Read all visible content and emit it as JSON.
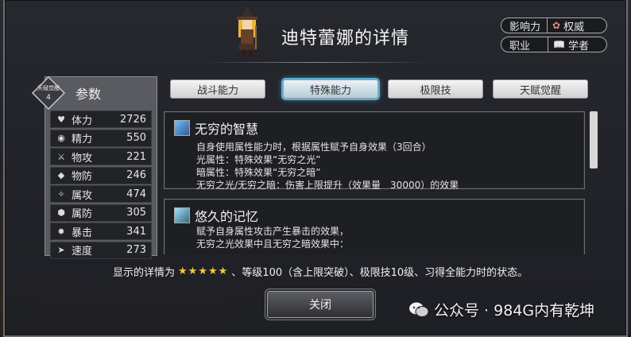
{
  "dialog": {
    "title": "迪特蕾娜的详情",
    "influence": {
      "label": "影响力",
      "value": "权威"
    },
    "job": {
      "label": "职业",
      "value": "学者"
    }
  },
  "left_panel": {
    "awaken_badge_label": "天赋觉醒",
    "awaken_badge_value": "4",
    "heading": "参数",
    "stats": [
      {
        "name": "体力",
        "value": "2726",
        "icon": "heart-icon"
      },
      {
        "name": "精力",
        "value": "550",
        "icon": "drop-icon"
      },
      {
        "name": "物攻",
        "value": "221",
        "icon": "sword-icon"
      },
      {
        "name": "物防",
        "value": "246",
        "icon": "shield-icon"
      },
      {
        "name": "属攻",
        "value": "474",
        "icon": "sparkle-icon"
      },
      {
        "name": "属防",
        "value": "305",
        "icon": "barrier-icon"
      },
      {
        "name": "暴击",
        "value": "341",
        "icon": "crit-icon"
      },
      {
        "name": "速度",
        "value": "273",
        "icon": "boot-icon"
      }
    ]
  },
  "tabs": [
    {
      "label": "战斗能力"
    },
    {
      "label": "特殊能力"
    },
    {
      "label": "极限技"
    },
    {
      "label": "天赋觉醒"
    }
  ],
  "active_tab": "特殊能力",
  "skills": [
    {
      "name": "无穷的智慧",
      "lines": [
        "自身使用属性能力时，根据属性赋予自身效果（3回合）",
        "光属性：特殊效果“无穷之光”",
        "暗属性：特殊效果“无穷之暗”",
        "无穷之光/无穷之暗：伤害上限提升（效果量　30000）的效果"
      ]
    },
    {
      "name": "悠久的记忆",
      "lines": [
        "赋予自身属性攻击产生暴击的效果，",
        "无穷之光效果中且无穷之暗效果中："
      ]
    }
  ],
  "footer": {
    "prefix": "显示的详情为",
    "stars": "★★★★★",
    "suffix": "、等级100（含上限突破）、极限技10级、习得全能力时的状态。"
  },
  "close_label": "关闭",
  "watermark": "公众号 · 984G内有乾坤",
  "colors": {
    "accent": "#4aa8d8",
    "star": "#f2c640",
    "panel": "#5a5b60"
  }
}
